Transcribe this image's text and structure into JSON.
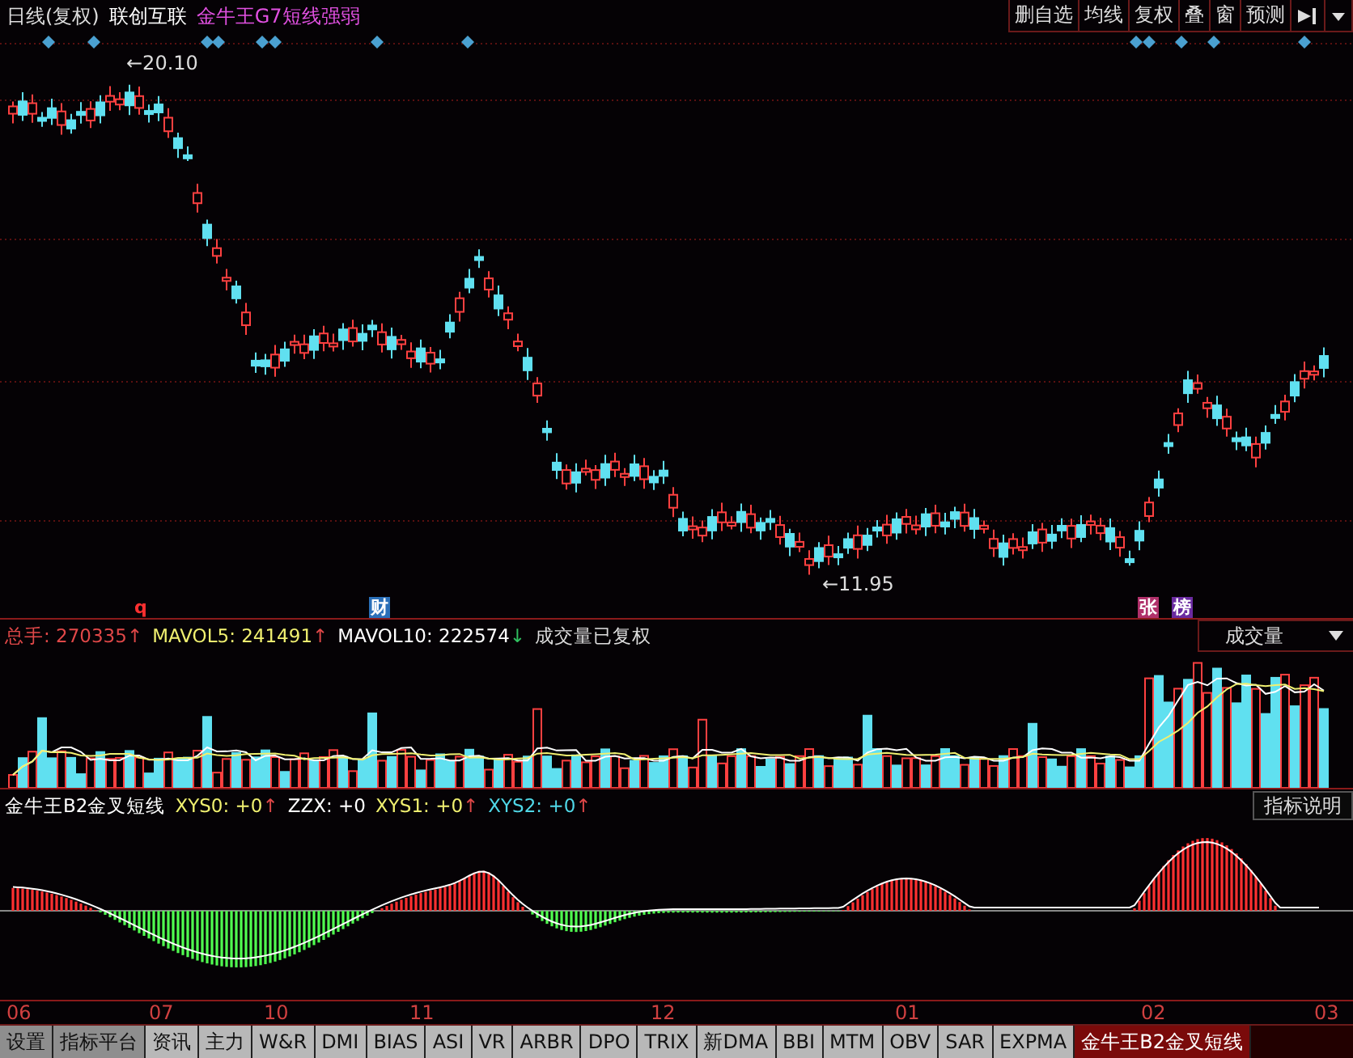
{
  "header": {
    "period": "日线(复权)",
    "stock": "联创互联",
    "indicator": "金牛王G7短线强弱"
  },
  "toolbar": [
    {
      "label": "删自选"
    },
    {
      "label": "均线"
    },
    {
      "label": "复权"
    },
    {
      "label": "叠"
    },
    {
      "label": "窗"
    },
    {
      "label": "预测"
    }
  ],
  "price_labels": [
    {
      "text": "←20.10"
    },
    {
      "text": "←11.95"
    }
  ],
  "event_marks": [
    {
      "label": "q",
      "color": "#ff3030"
    },
    {
      "label": "财",
      "color": "#2a6fb8"
    },
    {
      "label": "张",
      "color": "#b0306a"
    },
    {
      "label": "榜",
      "color": "#6a2aa0"
    }
  ],
  "volume": {
    "readings": [
      {
        "label": "总手:",
        "value": "270335",
        "arrow": "↑",
        "color": "#e04848"
      },
      {
        "label": "MAVOL5:",
        "value": "241491",
        "arrow": "↑",
        "color": "#f0f070"
      },
      {
        "label": "MAVOL10:",
        "value": "222574",
        "arrow": "↓",
        "color": "#ffffff"
      }
    ],
    "note": "成交量已复权",
    "selector": "成交量"
  },
  "indicator": {
    "name": "金牛王B2金叉短线",
    "readings": [
      {
        "label": "XYS0:",
        "value": "+0",
        "arrow": "↑",
        "color": "#f0f070"
      },
      {
        "label": "ZZX:",
        "value": "+0",
        "color": "#ffffff"
      },
      {
        "label": "XYS1:",
        "value": "+0",
        "arrow": "↑",
        "color": "#f0f070"
      },
      {
        "label": "XYS2:",
        "value": "+0",
        "arrow": "↑",
        "color": "#50d8e8"
      }
    ],
    "button": "指标说明"
  },
  "x_axis": [
    "06",
    "07",
    "10",
    "11",
    "12",
    "01",
    "02",
    "03"
  ],
  "tabs": [
    {
      "label": "设置",
      "kind": "tool",
      "selected": false
    },
    {
      "label": "指标平台",
      "kind": "tool",
      "selected": false
    },
    {
      "label": "资讯",
      "kind": "indicator",
      "selected": false
    },
    {
      "label": "主力",
      "kind": "indicator",
      "selected": false
    },
    {
      "label": "W&R",
      "kind": "indicator",
      "selected": false
    },
    {
      "label": "DMI",
      "kind": "indicator",
      "selected": false
    },
    {
      "label": "BIAS",
      "kind": "indicator",
      "selected": false
    },
    {
      "label": "ASI",
      "kind": "indicator",
      "selected": false
    },
    {
      "label": "VR",
      "kind": "indicator",
      "selected": false
    },
    {
      "label": "ARBR",
      "kind": "indicator",
      "selected": false
    },
    {
      "label": "DPO",
      "kind": "indicator",
      "selected": false
    },
    {
      "label": "TRIX",
      "kind": "indicator",
      "selected": false
    },
    {
      "label": "新DMA",
      "kind": "indicator",
      "selected": false
    },
    {
      "label": "BBI",
      "kind": "indicator",
      "selected": false
    },
    {
      "label": "MTM",
      "kind": "indicator",
      "selected": false
    },
    {
      "label": "OBV",
      "kind": "indicator",
      "selected": false
    },
    {
      "label": "SAR",
      "kind": "indicator",
      "selected": false
    },
    {
      "label": "EXPMA",
      "kind": "indicator",
      "selected": false
    },
    {
      "label": "金牛王B2金叉短线",
      "kind": "indicator",
      "selected": true
    }
  ]
}
